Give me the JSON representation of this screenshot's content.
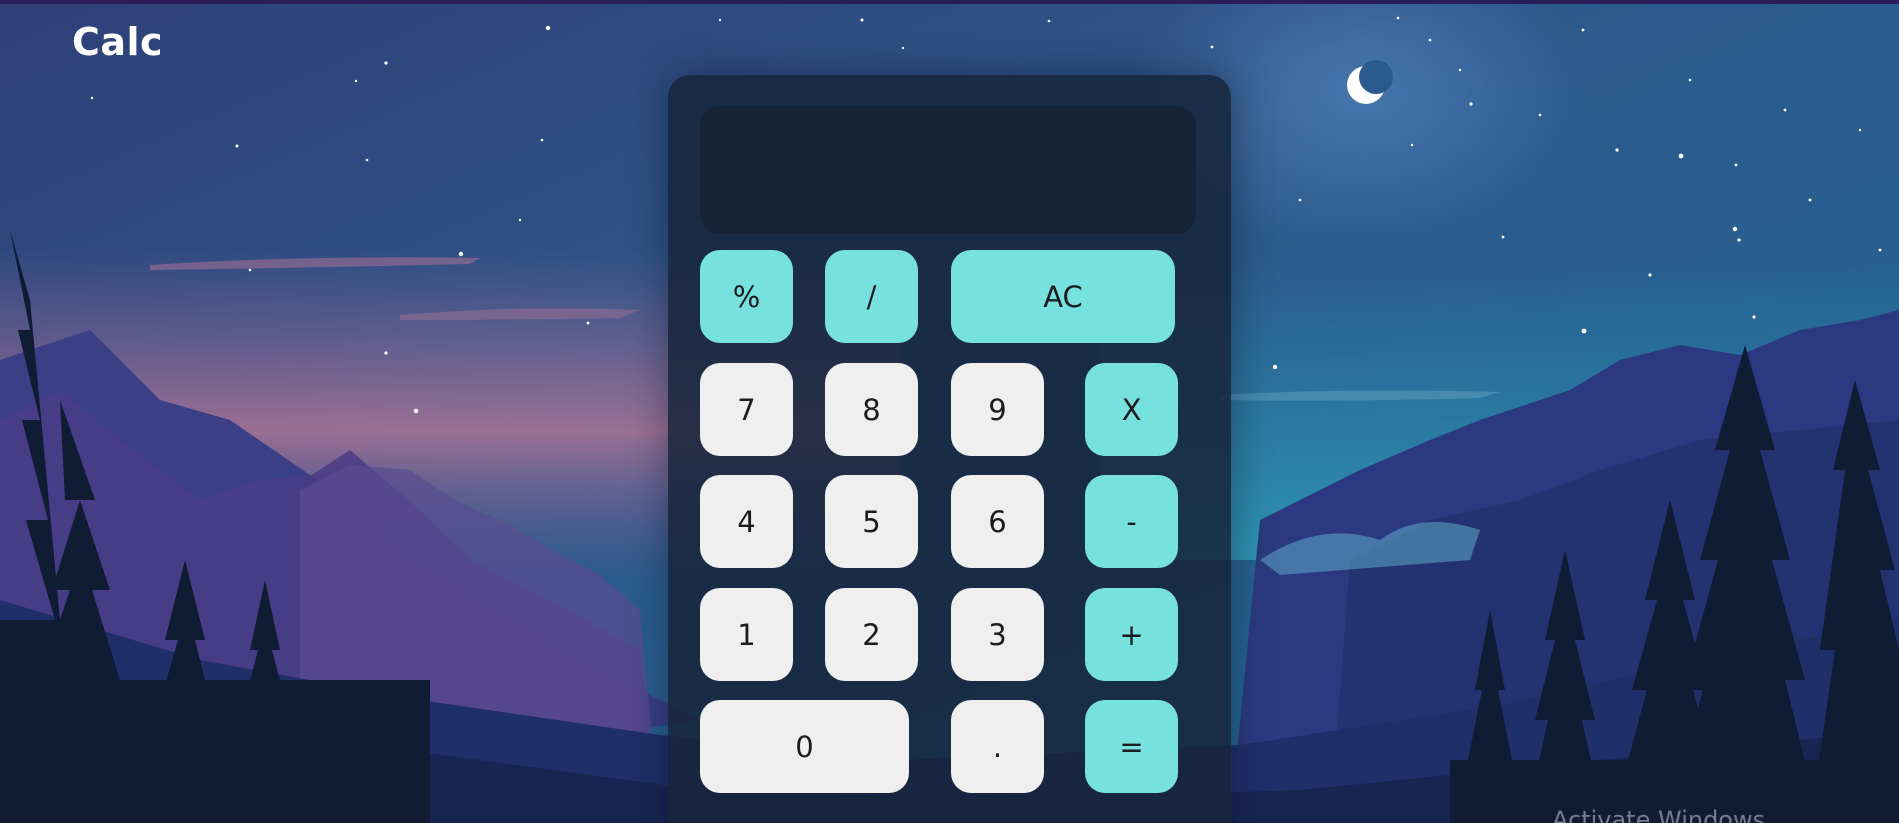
{
  "app": {
    "brand": "Calc",
    "watermark": "Activate Windows"
  },
  "calculator": {
    "display_value": "",
    "keys": {
      "percent": "%",
      "divide": "/",
      "clear": "AC",
      "seven": "7",
      "eight": "8",
      "nine": "9",
      "multiply": "X",
      "four": "4",
      "five": "5",
      "six": "6",
      "minus": "-",
      "one": "1",
      "two": "2",
      "three": "3",
      "plus": "+",
      "zero": "0",
      "decimal": ".",
      "equals": "="
    }
  },
  "colors": {
    "operator_key": "#76e1de",
    "number_key": "#efefef",
    "calculator_body": "#16243a",
    "display": "#162336",
    "brand_text": "#ffffff"
  },
  "background": {
    "scene": "night-sky-mountain-forest-illustration",
    "icon": "crescent-moon-icon"
  }
}
